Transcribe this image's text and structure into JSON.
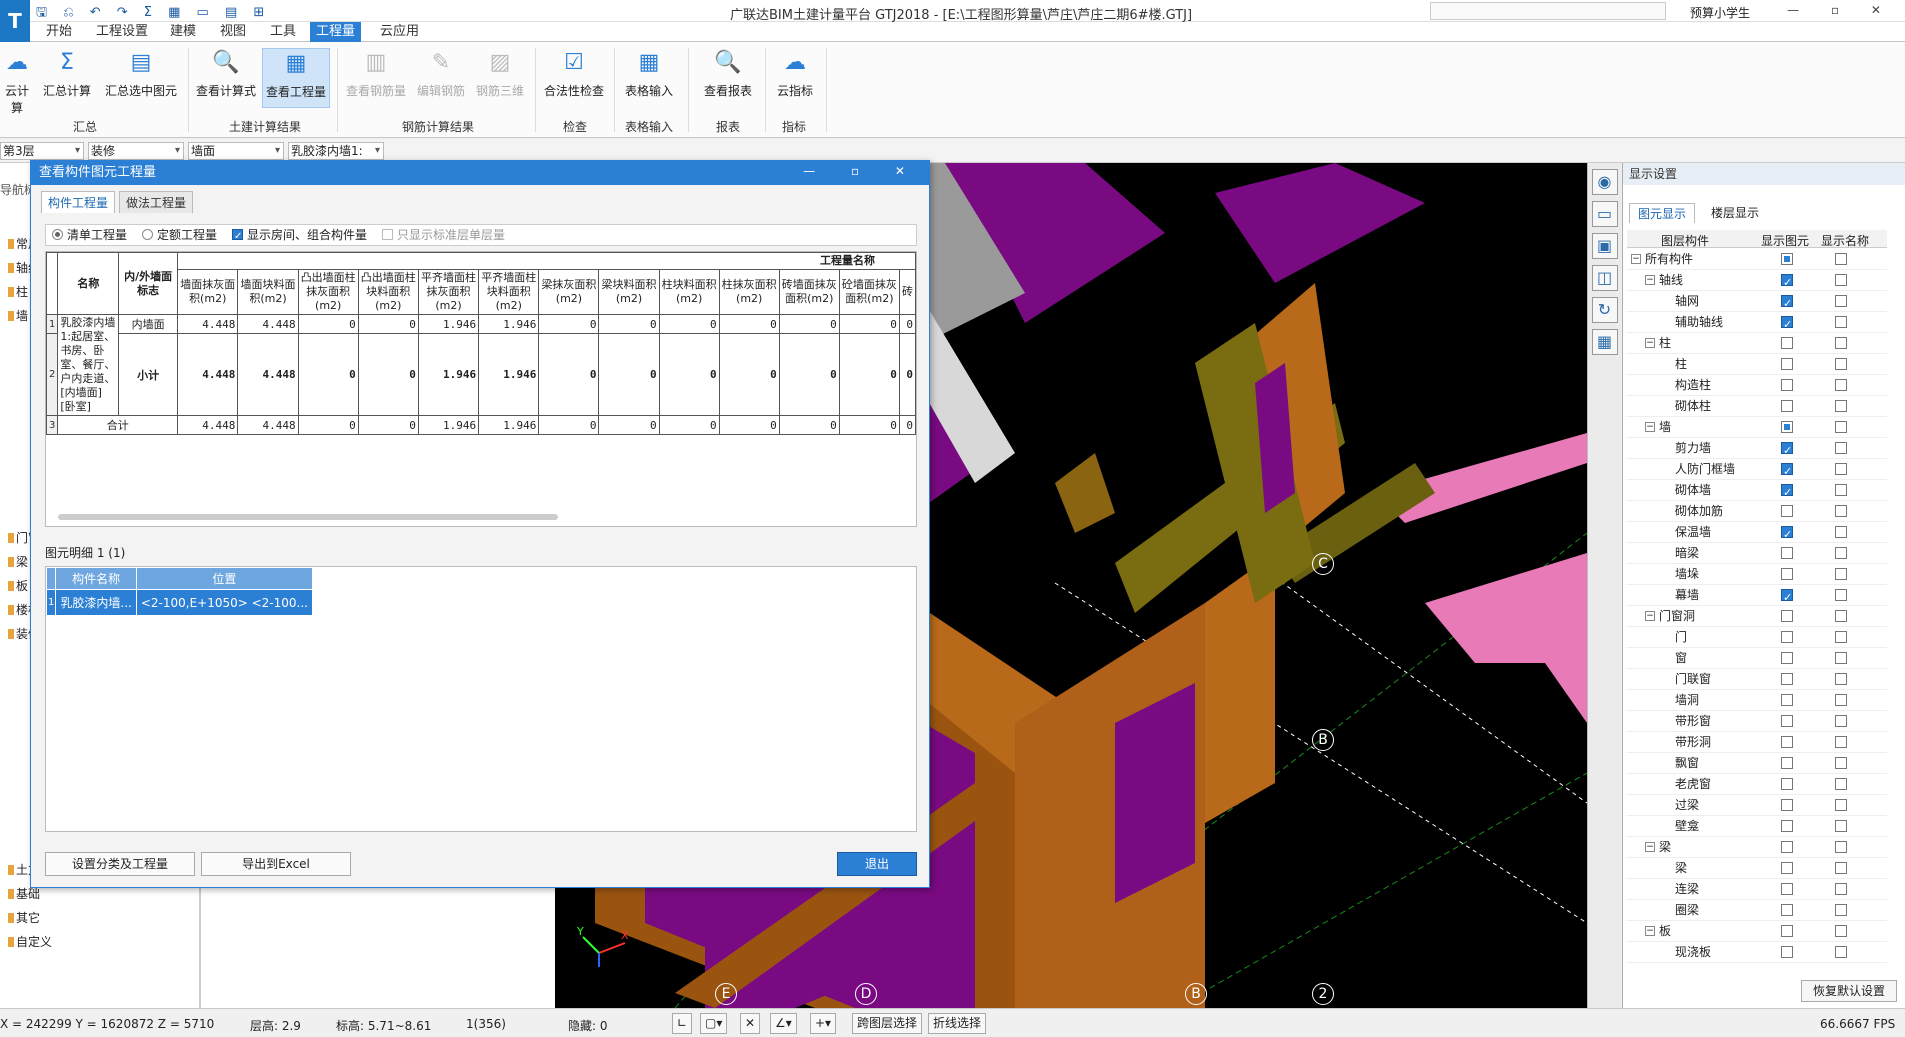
{
  "app": {
    "logo": "T",
    "quick_access": "🖫 ⎌ ↶ ↷ Σ ▦ ▭ ▤ ⊞",
    "title": "广联达BIM土建计量平台 GTJ2018 - [E:\\工程图形算量\\芦庄\\芦庄二期6#楼.GTJ]",
    "user": "预算小学生",
    "window_buttons": "— ▫ ✕"
  },
  "menu_tabs": [
    "开始",
    "工程设置",
    "建模",
    "视图",
    "工具",
    "工程量",
    "云应用"
  ],
  "ribbon": {
    "buttons": [
      {
        "label": "云计算",
        "icon": "cloud-calc-icon"
      },
      {
        "label": "汇总计算",
        "icon": "sigma-icon"
      },
      {
        "label": "汇总选中图元",
        "icon": "sum-selected-icon"
      },
      {
        "label": "查看计算式",
        "icon": "formula-icon"
      },
      {
        "label": "查看工程量",
        "icon": "quantity-icon"
      },
      {
        "label": "查看钢筋量",
        "icon": "rebar-icon"
      },
      {
        "label": "编辑钢筋",
        "icon": "edit-rebar-icon"
      },
      {
        "label": "钢筋三维",
        "icon": "rebar-3d-icon"
      },
      {
        "label": "合法性检查",
        "icon": "check-icon"
      },
      {
        "label": "表格输入",
        "icon": "table-input-icon"
      },
      {
        "label": "查看报表",
        "icon": "report-icon"
      },
      {
        "label": "云指标",
        "icon": "cloud-index-icon"
      }
    ],
    "groups": [
      "汇总",
      "土建计算结果",
      "钢筋计算结果",
      "检查",
      "表格输入",
      "报表",
      "指标"
    ]
  },
  "toolbar2": {
    "floor": "第3层",
    "category": "装修",
    "type": "墙面",
    "component": "乳胶漆内墙1:"
  },
  "left_panel": {
    "title": "导航树",
    "items": [
      "常用",
      "轴线",
      "柱",
      "墙",
      "门窗",
      "梁",
      "板",
      "楼梯",
      "装修",
      "土方",
      "基础",
      "其它",
      "自定义"
    ]
  },
  "dialog": {
    "title": "查看构件图元工程量",
    "tabs": [
      "构件工程量",
      "做法工程量"
    ],
    "options": {
      "opt1": "清单工程量",
      "opt2": "定额工程量",
      "opt3": "显示房间、组合构件量",
      "opt4": "只显示标准层单层量"
    },
    "table": {
      "group_header": "工程量名称",
      "col_name": "名称",
      "col_inout": "内/外墙面标志",
      "columns": [
        "墙面抹灰面积(m2)",
        "墙面块料面积(m2)",
        "凸出墙面柱抹灰面积(m2)",
        "凸出墙面柱块料面积(m2)",
        "平齐墙面柱抹灰面积(m2)",
        "平齐墙面柱块料面积(m2)",
        "梁抹灰面积(m2)",
        "梁块料面积(m2)",
        "柱块料面积(m2)",
        "柱抹灰面积(m2)",
        "砖墙面抹灰面积(m2)",
        "砼墙面抹灰面积(m2)",
        "砖"
      ],
      "rows": [
        {
          "num": "1",
          "name": "乳胶漆内墙1:起居室、书房、卧室、餐厅、户内走道、[内墙面][卧室]",
          "flag": "内墙面",
          "values": [
            "4.448",
            "4.448",
            "0",
            "0",
            "1.946",
            "1.946",
            "0",
            "0",
            "0",
            "0",
            "0",
            "0",
            "0"
          ]
        },
        {
          "num": "2",
          "flag": "小计",
          "values": [
            "4.448",
            "4.448",
            "0",
            "0",
            "1.946",
            "1.946",
            "0",
            "0",
            "0",
            "0",
            "0",
            "0",
            "0"
          ]
        },
        {
          "num": "3",
          "name": "合计",
          "values": [
            "4.448",
            "4.448",
            "0",
            "0",
            "1.946",
            "1.946",
            "0",
            "0",
            "0",
            "0",
            "0",
            "0",
            "0"
          ]
        }
      ]
    },
    "detail": {
      "label": "图元明细  1 (1)",
      "columns": [
        "构件名称",
        "位置"
      ],
      "rows": [
        {
          "num": "1",
          "name": "乳胶漆内墙...",
          "pos": "<2-100,E+1050> <2-100..."
        }
      ]
    },
    "buttons": {
      "settings": "设置分类及工程量",
      "export": "导出到Excel",
      "exit": "退出"
    }
  },
  "viewport": {
    "axes": [
      "C",
      "B",
      "E",
      "D",
      "B",
      "2"
    ],
    "axis_colors": {
      "x": "#ff3030",
      "y": "#30ff30",
      "z": "#3060ff"
    }
  },
  "right_panel": {
    "title": "显示设置",
    "tabs": [
      "图元显示",
      "楼层显示"
    ],
    "headers": [
      "图层构件",
      "显示图元",
      "显示名称"
    ],
    "rows": [
      {
        "name": "所有构件",
        "level": 0,
        "group": true,
        "show": "part",
        "label": false
      },
      {
        "name": "轴线",
        "level": 1,
        "group": true,
        "show": "on",
        "label": false
      },
      {
        "name": "轴网",
        "level": 2,
        "show": "on",
        "label": false
      },
      {
        "name": "辅助轴线",
        "level": 2,
        "show": "on",
        "label": false
      },
      {
        "name": "柱",
        "level": 1,
        "group": true,
        "show": "off",
        "label": false
      },
      {
        "name": "柱",
        "level": 2,
        "show": "off",
        "label": false
      },
      {
        "name": "构造柱",
        "level": 2,
        "show": "off",
        "label": false
      },
      {
        "name": "砌体柱",
        "level": 2,
        "show": "off",
        "label": false
      },
      {
        "name": "墙",
        "level": 1,
        "group": true,
        "show": "part",
        "label": false
      },
      {
        "name": "剪力墙",
        "level": 2,
        "show": "on",
        "label": false
      },
      {
        "name": "人防门框墙",
        "level": 2,
        "show": "on",
        "label": false
      },
      {
        "name": "砌体墙",
        "level": 2,
        "show": "on",
        "label": false
      },
      {
        "name": "砌体加筋",
        "level": 2,
        "show": "off",
        "label": false
      },
      {
        "name": "保温墙",
        "level": 2,
        "show": "on",
        "label": false
      },
      {
        "name": "暗梁",
        "level": 2,
        "show": "off",
        "label": false
      },
      {
        "name": "墙垛",
        "level": 2,
        "show": "off",
        "label": false
      },
      {
        "name": "幕墙",
        "level": 2,
        "show": "on",
        "label": false
      },
      {
        "name": "门窗洞",
        "level": 1,
        "group": true,
        "show": "off",
        "label": false
      },
      {
        "name": "门",
        "level": 2,
        "show": "off",
        "label": false
      },
      {
        "name": "窗",
        "level": 2,
        "show": "off",
        "label": false
      },
      {
        "name": "门联窗",
        "level": 2,
        "show": "off",
        "label": false
      },
      {
        "name": "墙洞",
        "level": 2,
        "show": "off",
        "label": false
      },
      {
        "name": "带形窗",
        "level": 2,
        "show": "off",
        "label": false
      },
      {
        "name": "带形洞",
        "level": 2,
        "show": "off",
        "label": false
      },
      {
        "name": "飘窗",
        "level": 2,
        "show": "off",
        "label": false
      },
      {
        "name": "老虎窗",
        "level": 2,
        "show": "off",
        "label": false
      },
      {
        "name": "过梁",
        "level": 2,
        "show": "off",
        "label": false
      },
      {
        "name": "壁龛",
        "level": 2,
        "show": "off",
        "label": false
      },
      {
        "name": "梁",
        "level": 1,
        "group": true,
        "show": "off",
        "label": false
      },
      {
        "name": "梁",
        "level": 2,
        "show": "off",
        "label": false
      },
      {
        "name": "连梁",
        "level": 2,
        "show": "off",
        "label": false
      },
      {
        "name": "圈梁",
        "level": 2,
        "show": "off",
        "label": false
      },
      {
        "name": "板",
        "level": 1,
        "group": true,
        "show": "off",
        "label": false
      },
      {
        "name": "现浇板",
        "level": 2,
        "show": "off",
        "label": false
      }
    ],
    "restore": "恢复默认设置"
  },
  "status": {
    "coords": "X = 242299 Y = 1620872 Z = 5710",
    "floor_height": "层高:  2.9",
    "elevation": "标高:  5.71~8.61",
    "count": "1(356)",
    "hidden": "隐藏:  0",
    "cross_floor": "跨图层选择",
    "polyline_select": "折线选择",
    "fps": "66.6667 FPS"
  }
}
